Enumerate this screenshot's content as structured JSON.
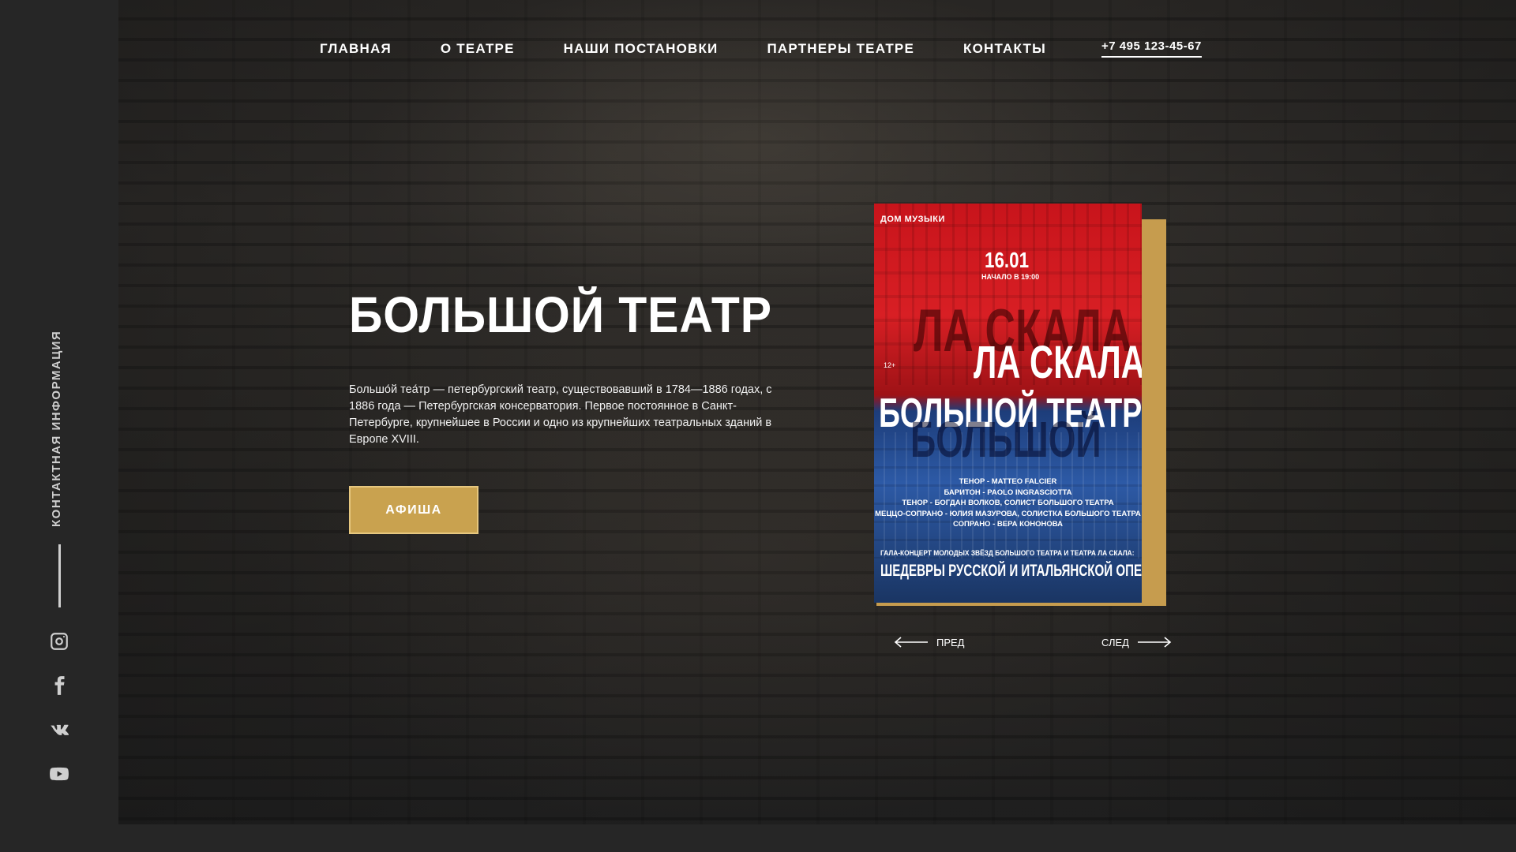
{
  "sidebar": {
    "contact_label": "КОНТАКТНАЯ ИНФОРМАЦИЯ",
    "socials": [
      "instagram-icon",
      "facebook-icon",
      "vk-icon",
      "youtube-icon"
    ]
  },
  "nav": {
    "items": [
      "ГЛАВНАЯ",
      "О ТЕАТРЕ",
      "НАШИ ПОСТАНОВКИ",
      "ПАРТНЕРЫ ТЕАТРЕ",
      "КОНТАКТЫ"
    ],
    "phone": "+7 495 123-45-67"
  },
  "hero": {
    "title": "БОЛЬШОЙ ТЕАТР",
    "description": "Большо́й теа́тр — петербургский театр, существовавший в 1784—1886 годах, с 1886 года — Петербургская консерватория. Первое постоянное в Санкт-Петербурге, крупнейшее в России и одно из крупнейших театральных зданий в Европе XVIII.",
    "button": "АФИША"
  },
  "poster": {
    "brand": "ДОМ МУЗЫКИ",
    "date": "16.01",
    "start": "НАЧАЛО В 19:00",
    "age": "12+",
    "ghost_top": "ЛА СКАЛА",
    "title1": "ЛА СКАЛА",
    "title2": "БОЛЬШОЙ ТЕАТР",
    "ghost_bottom": "БОЛЬШОЙ",
    "cast": [
      "ТЕНОР - MATTEO FALCIER",
      "БАРИТОН - PAOLO INGRASCIOTTA",
      "ТЕНОР - БОГДАН ВОЛКОВ, СОЛИСТ БОЛЬШОГО ТЕАТРА",
      "МЕЦЦО-СОПРАНО - ЮЛИЯ МАЗУРОВА, СОЛИСТКА БОЛЬШОГО ТЕАТРА",
      "СОПРАНО - ВЕРА КОНОНОВА"
    ],
    "gala": "ГАЛА-КОНЦЕРТ МОЛОДЫХ ЗВЁЗД БОЛЬШОГО ТЕАТРА И ТЕАТРА ЛА СКАЛА:",
    "show": "ШЕДЕВРЫ РУССКОЙ И ИТАЛЬЯНСКОЙ ОПЕРЫ"
  },
  "slider": {
    "prev": "ПРЕД",
    "next": "СЛЕД"
  },
  "colors": {
    "accent": "#c9a24f",
    "background": "#262626"
  }
}
